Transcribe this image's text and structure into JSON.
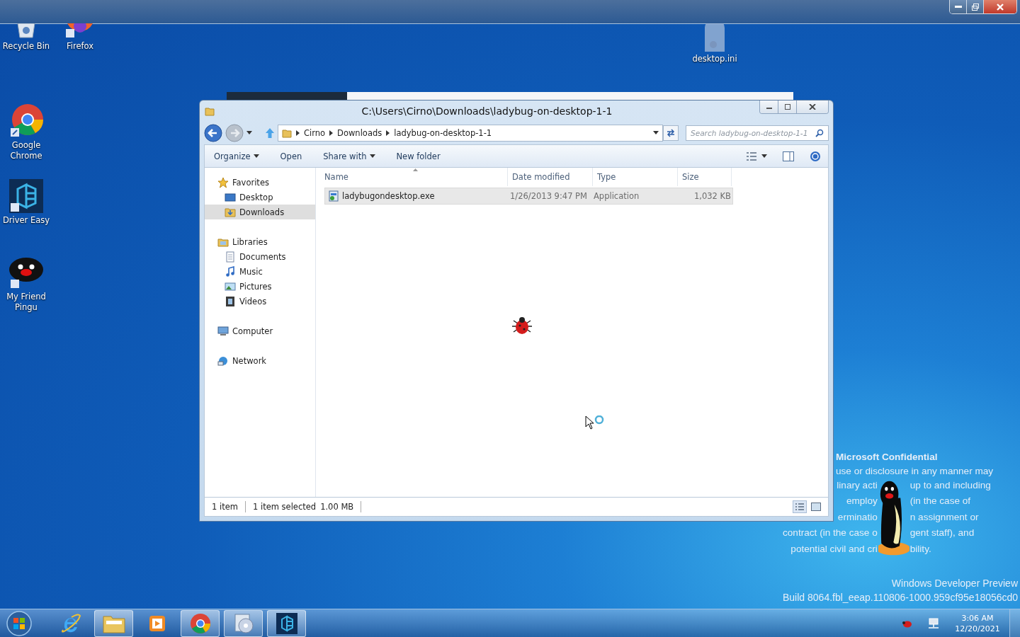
{
  "desktop_icons": [
    {
      "label": "Recycle Bin",
      "kind": "recycle"
    },
    {
      "label": "Firefox",
      "kind": "firefox"
    },
    {
      "label": "Google Chrome",
      "kind": "chrome"
    },
    {
      "label": "Driver Easy",
      "kind": "drivereasy"
    },
    {
      "label": "My Friend Pingu",
      "kind": "pingu"
    },
    {
      "label": "desktop.ini",
      "kind": "file"
    }
  ],
  "explorer": {
    "title": "C:\\Users\\Cirno\\Downloads\\ladybug-on-desktop-1-1",
    "breadcrumb": [
      "Cirno",
      "Downloads",
      "ladybug-on-desktop-1-1"
    ],
    "search": {
      "placeholder": "Search ladybug-on-desktop-1-1"
    },
    "toolbar": [
      {
        "label": "Organize",
        "dropdown": true
      },
      {
        "label": "Open",
        "dropdown": false
      },
      {
        "label": "Share with",
        "dropdown": true
      },
      {
        "label": "New folder",
        "dropdown": false
      }
    ],
    "sidebar": [
      {
        "label": "Favorites",
        "kind": "star",
        "selected": false,
        "children": [
          {
            "label": "Desktop",
            "kind": "desktop",
            "selected": false
          },
          {
            "label": "Downloads",
            "kind": "downloads",
            "selected": true
          }
        ]
      },
      {
        "label": "Libraries",
        "kind": "library",
        "selected": false,
        "children": [
          {
            "label": "Documents",
            "kind": "documents",
            "selected": false
          },
          {
            "label": "Music",
            "kind": "music",
            "selected": false
          },
          {
            "label": "Pictures",
            "kind": "pictures",
            "selected": false
          },
          {
            "label": "Videos",
            "kind": "videos",
            "selected": false
          }
        ]
      },
      {
        "label": "Computer",
        "kind": "computer",
        "selected": false
      },
      {
        "label": "Network",
        "kind": "network",
        "selected": false
      }
    ],
    "columns": [
      "Name",
      "Date modified",
      "Type",
      "Size"
    ],
    "rows": [
      {
        "name": "ladybugondesktop.exe",
        "date": "1/26/2013 9:47 PM",
        "type": "Application",
        "size": "1,032 KB",
        "selected": true
      }
    ],
    "status": {
      "count": "1 item",
      "selection": "1 item selected",
      "size": "1.00 MB"
    }
  },
  "watermark": {
    "title": "Microsoft Confidential",
    "lines": [
      {
        "left": "use or disclosure in any manner may"
      },
      {
        "left": "linary acti",
        "right": "up to and including"
      },
      {
        "left": "employ",
        "right": "(in the case of"
      },
      {
        "left": "erminatio",
        "right": "n assignment or"
      },
      {
        "left": "contract (in the case o",
        "right": "gent staff), and"
      },
      {
        "left": "potential civil and cri",
        "right": "bility."
      }
    ],
    "edition": "Windows Developer Preview",
    "build": "Build 8064.fbl_eeap.110806-1000.959cf95e18056cd0"
  },
  "taskbar": {
    "apps": [
      {
        "kind": "ie",
        "running": false
      },
      {
        "kind": "explorer",
        "running": true
      },
      {
        "kind": "media",
        "running": false
      },
      {
        "kind": "chrome",
        "running": true
      },
      {
        "kind": "disc",
        "running": true
      },
      {
        "kind": "drivereasy",
        "running": true
      }
    ],
    "time": "3:06 AM",
    "date": "12/20/2021"
  }
}
